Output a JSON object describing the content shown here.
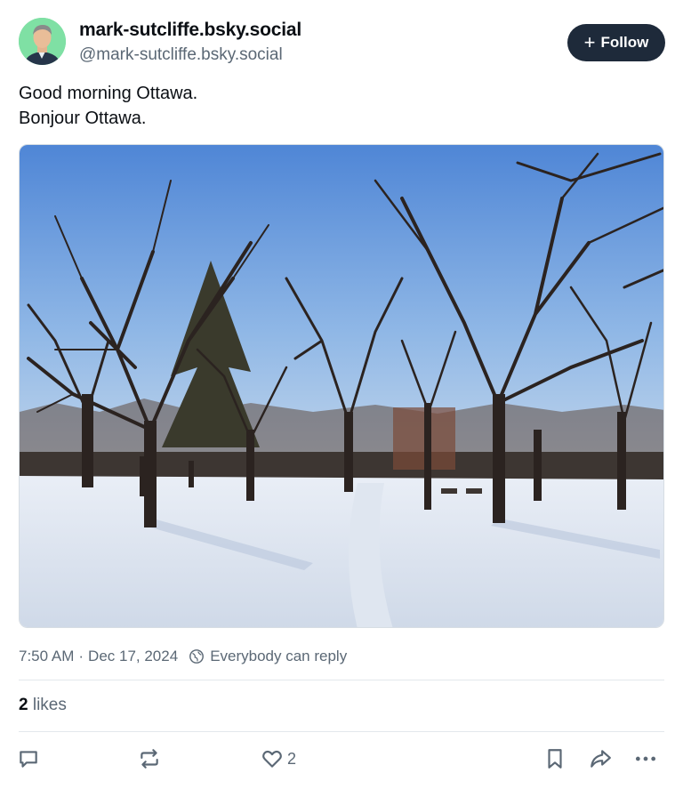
{
  "author": {
    "display_name": "mark-sutcliffe.bsky.social",
    "handle": "@mark-sutcliffe.bsky.social"
  },
  "follow_button": {
    "label": "Follow",
    "icon": "plus-icon"
  },
  "post": {
    "lines": [
      "Good morning Ottawa.",
      "Bonjour Ottawa."
    ],
    "image_subject": "snowy park with bare trees under blue sky"
  },
  "meta": {
    "time": "7:50 AM",
    "date": "Dec 17, 2024",
    "reply_setting": "Everybody can reply"
  },
  "stats": {
    "likes_count": "2",
    "likes_label": "likes"
  },
  "actions": {
    "reply_icon": "reply-icon",
    "repost_icon": "repost-icon",
    "like_icon": "heart-icon",
    "like_count": "2",
    "bookmark_icon": "bookmark-icon",
    "share_icon": "share-icon",
    "more_icon": "more-icon"
  },
  "colors": {
    "follow_bg": "#1e2a3a",
    "muted_text": "#5b6875",
    "avatar_bg": "#7fe0a4"
  }
}
